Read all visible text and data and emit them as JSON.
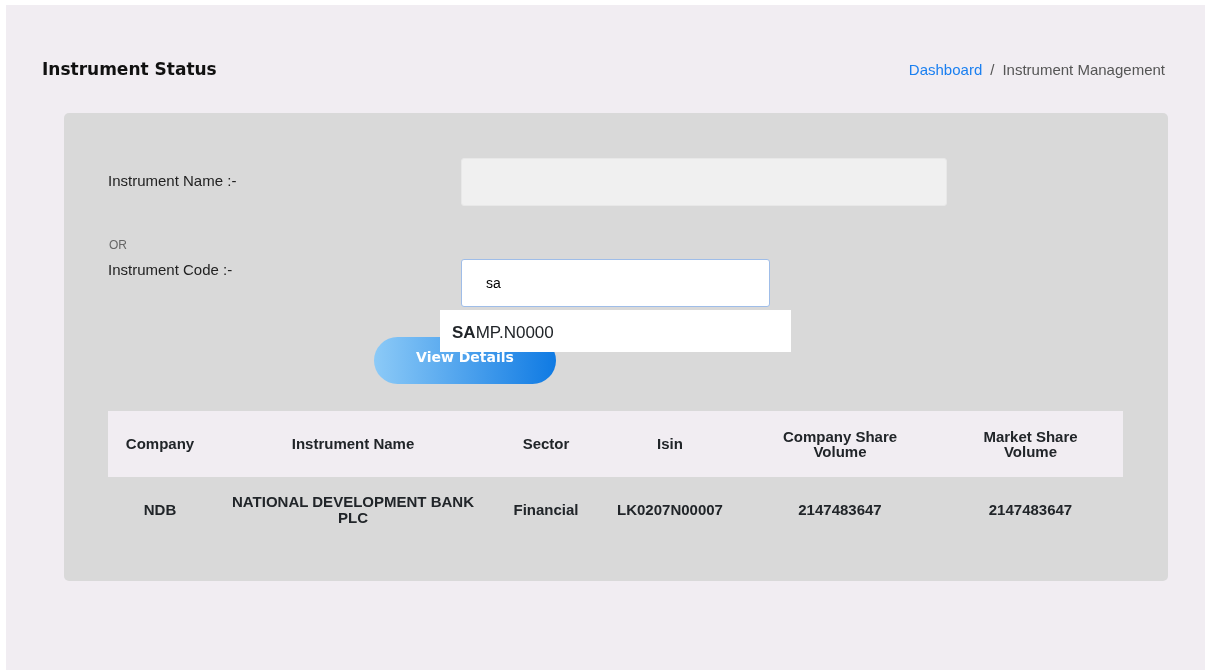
{
  "page_title": "Instrument Status",
  "breadcrumb": [
    {
      "label": "Dashboard",
      "link": true
    },
    {
      "label": "/",
      "link": false
    },
    {
      "label": "Instrument Management",
      "link": false
    }
  ],
  "form": {
    "name_label": "Instrument Name :-",
    "or_text": "OR",
    "code_label": "Instrument Code :-",
    "code_value": "sa",
    "suggestions": [
      "**SA**MP.N0000"
    ],
    "button": "View Details"
  },
  "table": {
    "columns": [
      "Company",
      "Instrument Name",
      "Sector",
      "Isin",
      "Company Share Volume",
      "Market Share Volume"
    ],
    "rows": [
      [
        "NDB",
        "NATIONAL DEVELOPMENT BANK PLC",
        "Financial",
        "LK0207N00007",
        "2147483647",
        "2147483647"
      ]
    ]
  }
}
